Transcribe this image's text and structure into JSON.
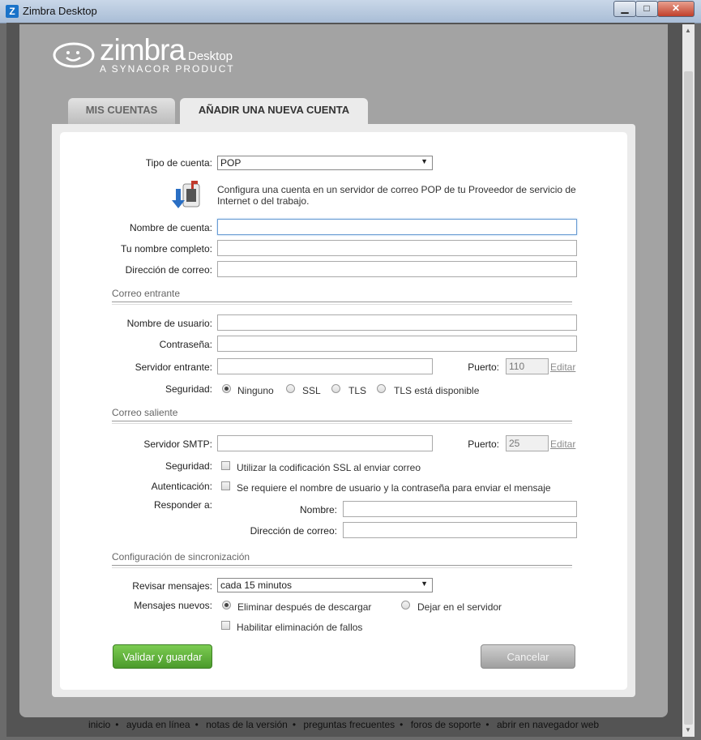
{
  "window": {
    "title": "Zimbra Desktop",
    "app_icon": "Z"
  },
  "brand": {
    "name": "zimbra",
    "product": "Desktop",
    "tagline": "A SYNACOR PRODUCT"
  },
  "tabs": [
    {
      "label": "MIS CUENTAS",
      "active": false
    },
    {
      "label": "AÑADIR UNA NUEVA CUENTA",
      "active": true
    }
  ],
  "form": {
    "account_type": {
      "label": "Tipo de cuenta:",
      "value": "POP"
    },
    "description": "Configura una cuenta en un servidor de correo POP de tu Proveedor de servicio de Internet o del trabajo.",
    "account_name": {
      "label": "Nombre de cuenta:",
      "value": ""
    },
    "full_name": {
      "label": "Tu nombre completo:",
      "value": ""
    },
    "email": {
      "label": "Dirección de correo:",
      "value": ""
    },
    "incoming": {
      "section": "Correo entrante",
      "username": {
        "label": "Nombre de usuario:",
        "value": ""
      },
      "password": {
        "label": "Contraseña:",
        "value": ""
      },
      "server": {
        "label": "Servidor entrante:",
        "value": ""
      },
      "port": {
        "label": "Puerto:",
        "value": "110",
        "edit": "Editar"
      },
      "security": {
        "label": "Seguridad:",
        "options": [
          "Ninguno",
          "SSL",
          "TLS",
          "TLS está disponible"
        ],
        "selected": "Ninguno"
      }
    },
    "outgoing": {
      "section": "Correo saliente",
      "server": {
        "label": "Servidor SMTP:",
        "value": ""
      },
      "port": {
        "label": "Puerto:",
        "value": "25",
        "edit": "Editar"
      },
      "security": {
        "label": "Seguridad:",
        "checkbox": "Utilizar la codificación SSL al enviar correo",
        "checked": false
      },
      "auth": {
        "label": "Autenticación:",
        "checkbox": "Se requiere el nombre de usuario y la contraseña para enviar el mensaje",
        "checked": false
      },
      "reply_to": {
        "label": "Responder a:",
        "name_label": "Nombre:",
        "name_value": "",
        "email_label": "Dirección de correo:",
        "email_value": ""
      }
    },
    "sync": {
      "section": "Configuración de sincronización",
      "check": {
        "label": "Revisar mensajes:",
        "value": "cada 15 minutos"
      },
      "new_messages": {
        "label": "Mensajes nuevos:",
        "options": [
          "Eliminar después de descargar",
          "Dejar en el servidor"
        ],
        "selected": "Eliminar después de descargar"
      },
      "debug": {
        "checkbox": "Habilitar eliminación de fallos",
        "checked": false
      }
    },
    "buttons": {
      "save": "Validar y guardar",
      "cancel": "Cancelar"
    }
  },
  "footer": [
    "inicio",
    "ayuda en línea",
    "notas de la versión",
    "preguntas frecuentes",
    "foros de soporte",
    "abrir en navegador web"
  ],
  "colors": {
    "save_green": "#5aad36",
    "accent_blue": "#1a73c9"
  }
}
